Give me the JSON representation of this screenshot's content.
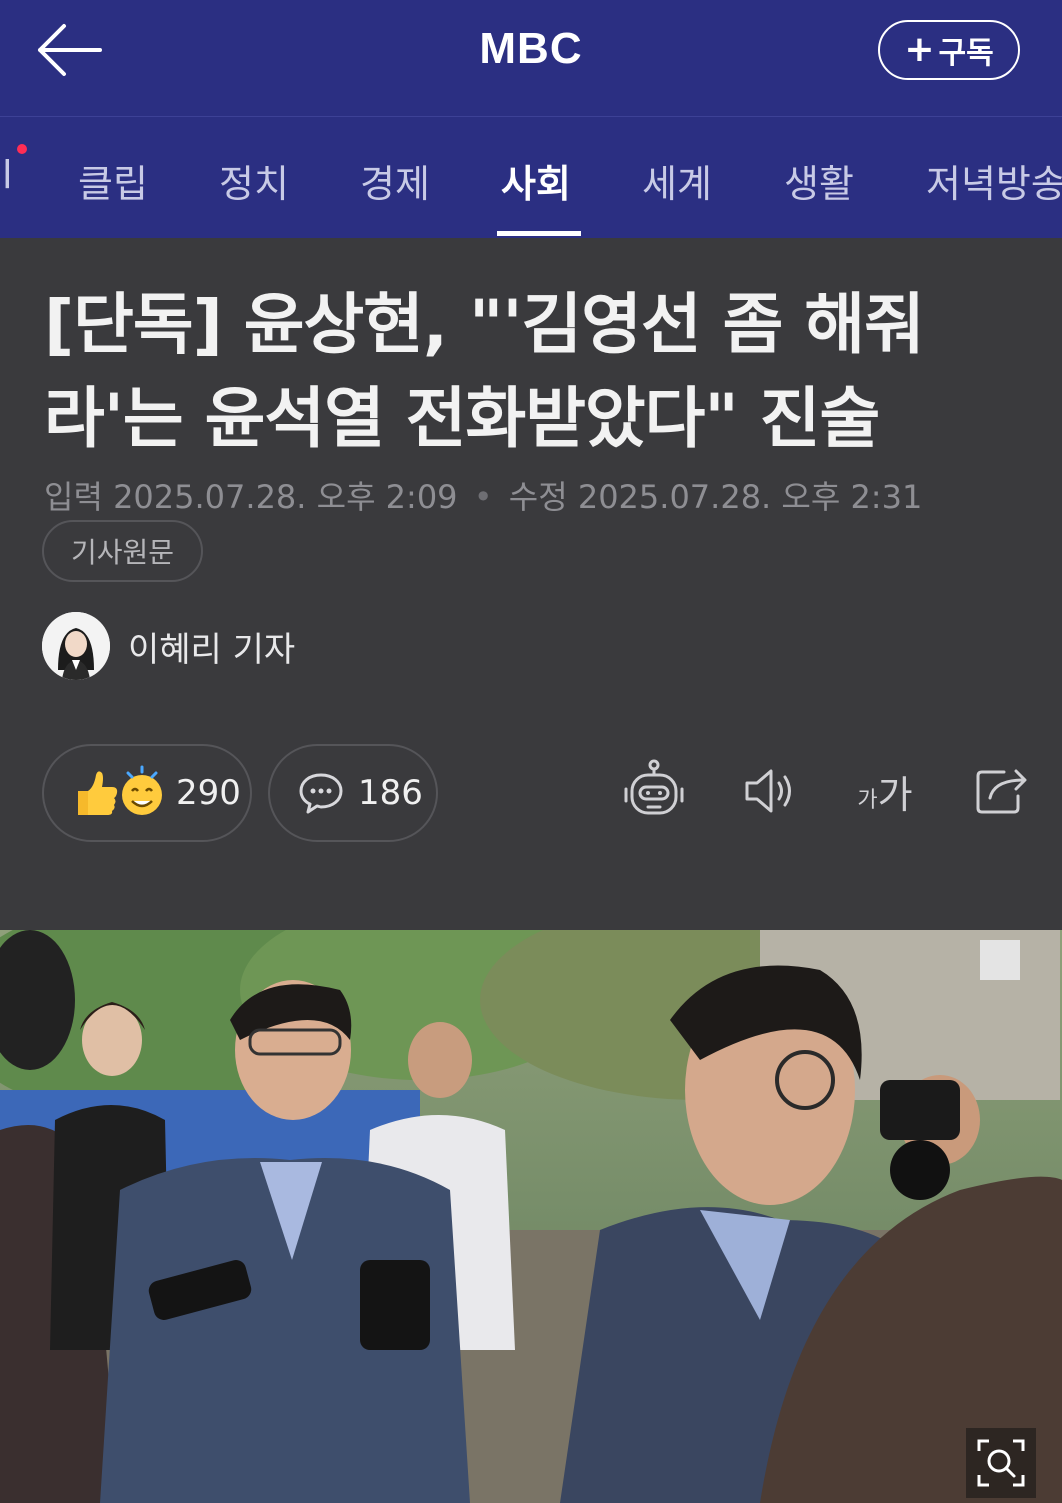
{
  "header": {
    "brand": "MBC",
    "subscribe_label": "구독",
    "back_icon": "arrow-left-icon"
  },
  "tabs": [
    {
      "label": "l"
    },
    {
      "label": "클립"
    },
    {
      "label": "정치"
    },
    {
      "label": "경제"
    },
    {
      "label": "사회",
      "active": true
    },
    {
      "label": "세계"
    },
    {
      "label": "생활"
    },
    {
      "label": "저녁방송"
    }
  ],
  "article": {
    "title_line1": "[단독] 윤상현, \"'김영선 좀 해줘",
    "title_line2": "라'는 윤석열 전화받았다\" 진술",
    "input_label": "입력",
    "input_time": "2025.07.28. 오후 2:09",
    "edit_label": "수정",
    "edit_time": "2025.07.28. 오후 2:31",
    "source_label": "기사원문",
    "reporter": "이혜리 기자"
  },
  "actions": {
    "reaction_count": "290",
    "comment_count": "186",
    "font_size_label_small": "가",
    "font_size_label_large": "가"
  },
  "colors": {
    "header_bg": "#2b2f82",
    "body_bg": "#3a3a3d",
    "active_tab": "#ffffff",
    "inactive_tab": "#c8cae6"
  }
}
